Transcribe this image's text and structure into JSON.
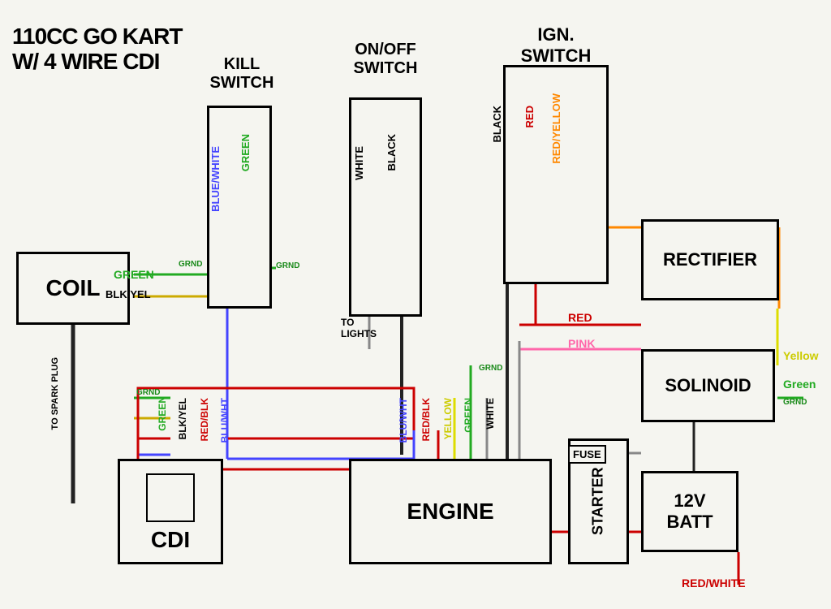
{
  "title": {
    "line1": "110CC GO KART",
    "line2": "W/ 4 WIRE CDI"
  },
  "components": {
    "kill_switch": {
      "label": "KILL\nSWITCH"
    },
    "onoff_switch": {
      "label": "ON/OFF\nSWITCH"
    },
    "ign_switch": {
      "label": "IGN.\nSWITCH"
    },
    "coil": {
      "label": "COIL"
    },
    "cdi": {
      "label": "CDI"
    },
    "engine": {
      "label": "ENGINE"
    },
    "rectifier": {
      "label": "RECTIFIER"
    },
    "solinoid": {
      "label": "SOLINOID"
    },
    "starter": {
      "label": "STARTER"
    },
    "batt": {
      "label": "12V\nBATT"
    },
    "fuse": {
      "label": "FUSE"
    }
  },
  "wire_labels": {
    "blue_white": "BLUE/WHITE",
    "green_kill": "GREEN",
    "white_onoff": "WHITE",
    "black_onoff": "BLACK",
    "black_ign": "BLACK",
    "red_ign": "RED",
    "red_yellow_ign": "RED/YELLOW",
    "green_coil": "GREEN",
    "blk_yel_coil": "BLK/YEL",
    "to_spark_plug": "TO SPARK PLUG",
    "green_cdi": "GREEN",
    "blk_yel_cdi": "BLK/YEL",
    "red_blk": "RED/BLK",
    "blu_wht": "BLU/WHT",
    "blu_wht_eng": "BLU/WHT",
    "red_blk_eng": "RED/BLK",
    "yellow": "YELLOW",
    "green_eng": "GREEN",
    "white_eng": "WHITE",
    "red": "RED",
    "pink": "PINK",
    "yellow_sol": "YELLOW",
    "green_sol": "GREEN",
    "red_white": "RED/WHITE",
    "to_lights": "TO\nLIGHTS"
  },
  "grnd_labels": [
    "GRND",
    "GRND",
    "GRND",
    "GRND"
  ]
}
